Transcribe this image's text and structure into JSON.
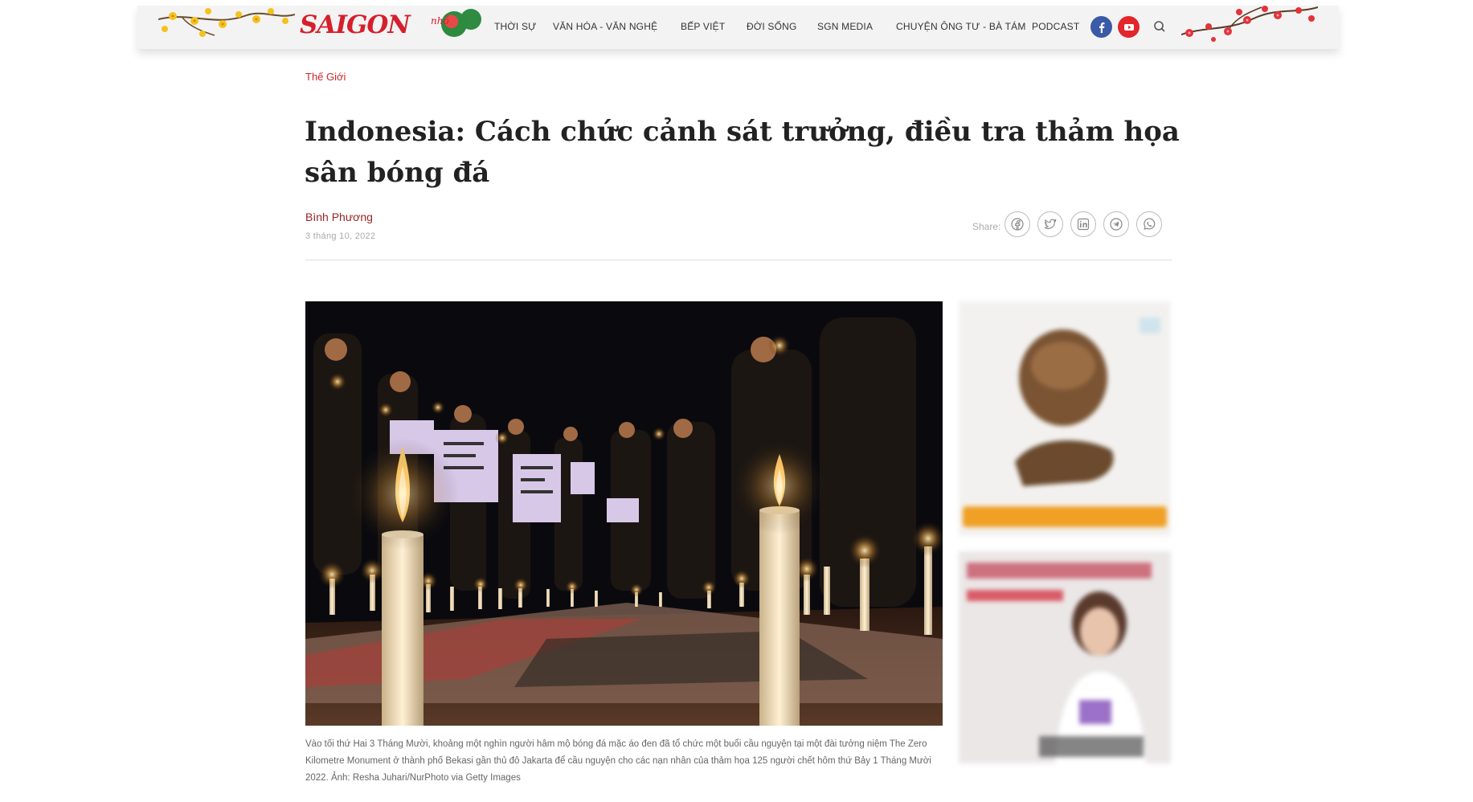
{
  "header": {
    "logo_text": "SAIGON",
    "logo_sub": "nhỏ",
    "nav": [
      "THỜI SỰ",
      "VĂN HÓA - VĂN NGHỆ",
      "BẾP VIỆT",
      "ĐỜI SỐNG",
      "SGN MEDIA",
      "CHUYỆN ÔNG TƯ - BÀ TÁM",
      "PODCAST"
    ],
    "social": [
      "facebook-icon",
      "youtube-icon"
    ],
    "search_icon": "search-icon"
  },
  "article": {
    "category": "Thế Giới",
    "title": "Indonesia: Cách chức cảnh sát trưởng, điều tra thảm họa sân bóng đá",
    "author": "Bình Phương",
    "date": "3 tháng 10, 2022",
    "share_label": "Share:",
    "share_icons": [
      "facebook-icon",
      "twitter-icon",
      "linkedin-icon",
      "telegram-icon",
      "whatsapp-icon"
    ],
    "caption": "Vào tối thứ Hai 3 Tháng Mười, khoảng một nghìn người hâm mộ bóng đá mặc áo đen đã tổ chức một buổi cầu nguyện tại một đài tưởng niệm The Zero Kilometre Monument ở thành phố Bekasi gần thủ đô Jakarta để cầu nguyện cho các nạn nhân của thảm họa 125 người chết hôm thứ Bảy 1 Tháng Mười 2022. Ảnh: Resha Juhari/NurPhoto via Getty Images"
  },
  "colors": {
    "brand_red": "#d61f2c",
    "category_red": "#c8282e",
    "author_red": "#9b2323"
  }
}
